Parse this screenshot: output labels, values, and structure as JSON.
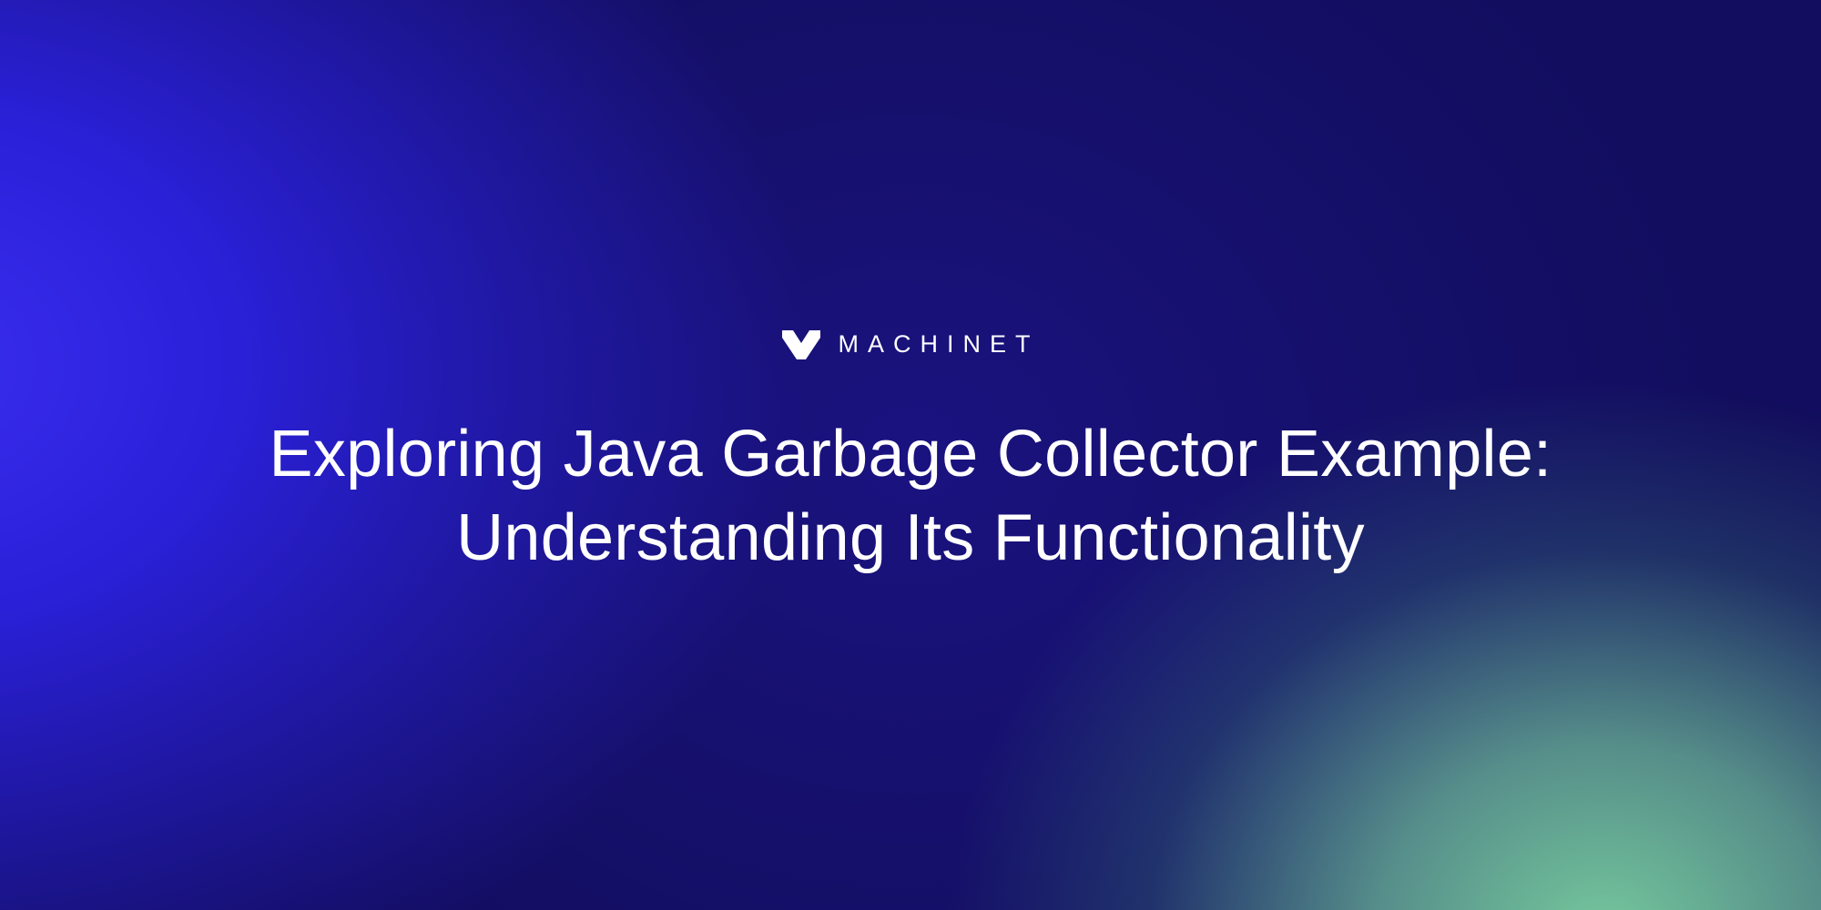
{
  "brand": {
    "name": "MACHINET"
  },
  "title": "Exploring Java Garbage Collector Example: Understanding Its Functionality"
}
